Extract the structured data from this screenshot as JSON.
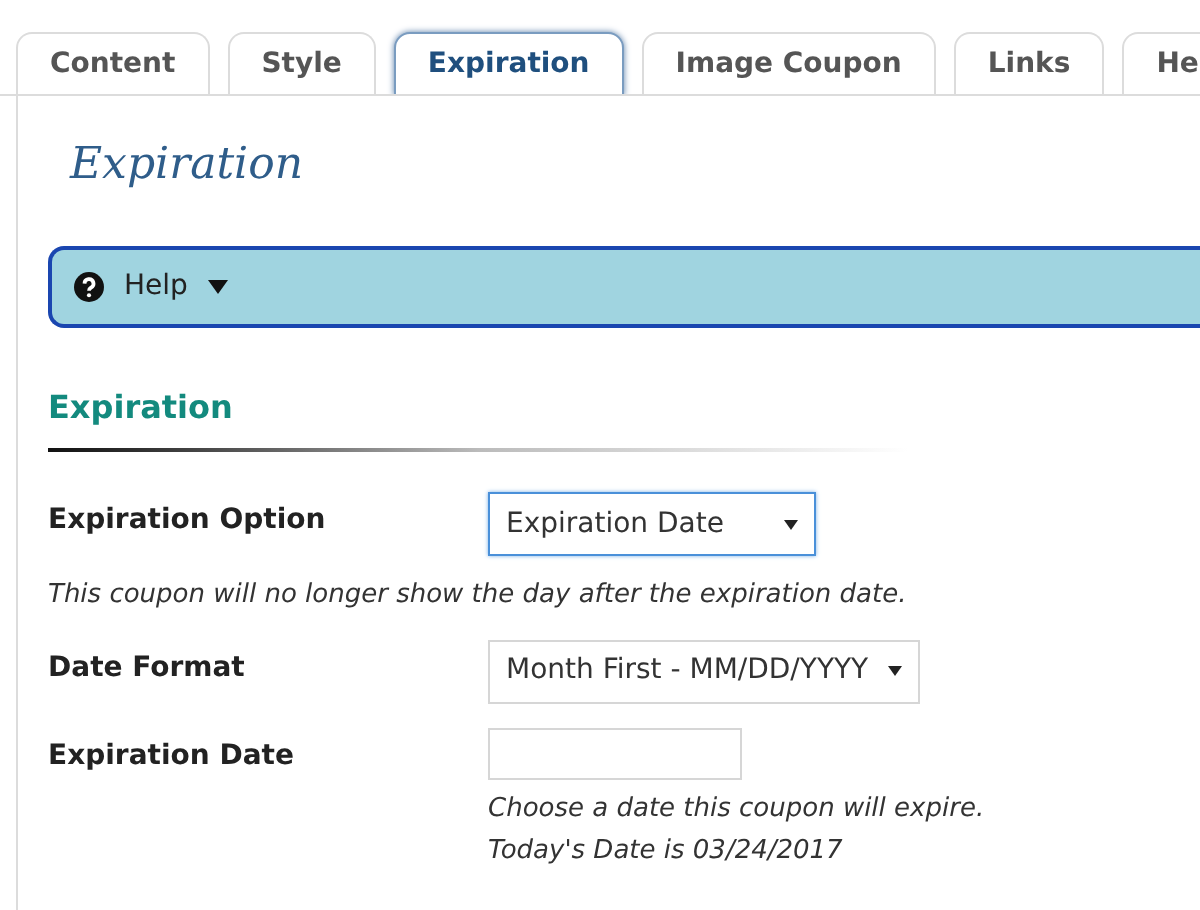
{
  "tabs": [
    {
      "label": "Content",
      "selected": false
    },
    {
      "label": "Style",
      "selected": false
    },
    {
      "label": "Expiration",
      "selected": true
    },
    {
      "label": "Image Coupon",
      "selected": false
    },
    {
      "label": "Links",
      "selected": false
    },
    {
      "label": "He",
      "selected": false
    }
  ],
  "page_title": "Expiration",
  "help": {
    "label": "Help",
    "expanded": false
  },
  "section_title": "Expiration",
  "fields": [
    {
      "kind": "select",
      "label": "Expiration Option",
      "value": "Expiration Date",
      "focused": true,
      "note": "This coupon will no longer show the day after the expiration date."
    },
    {
      "kind": "select",
      "label": "Date Format",
      "value": "Month First - MM/DD/YYYY",
      "focused": false
    },
    {
      "kind": "text",
      "label": "Expiration Date",
      "focused": false,
      "hints": [
        "Choose a date this coupon will expire.",
        "Today's Date is 03/24/2017"
      ]
    }
  ]
}
